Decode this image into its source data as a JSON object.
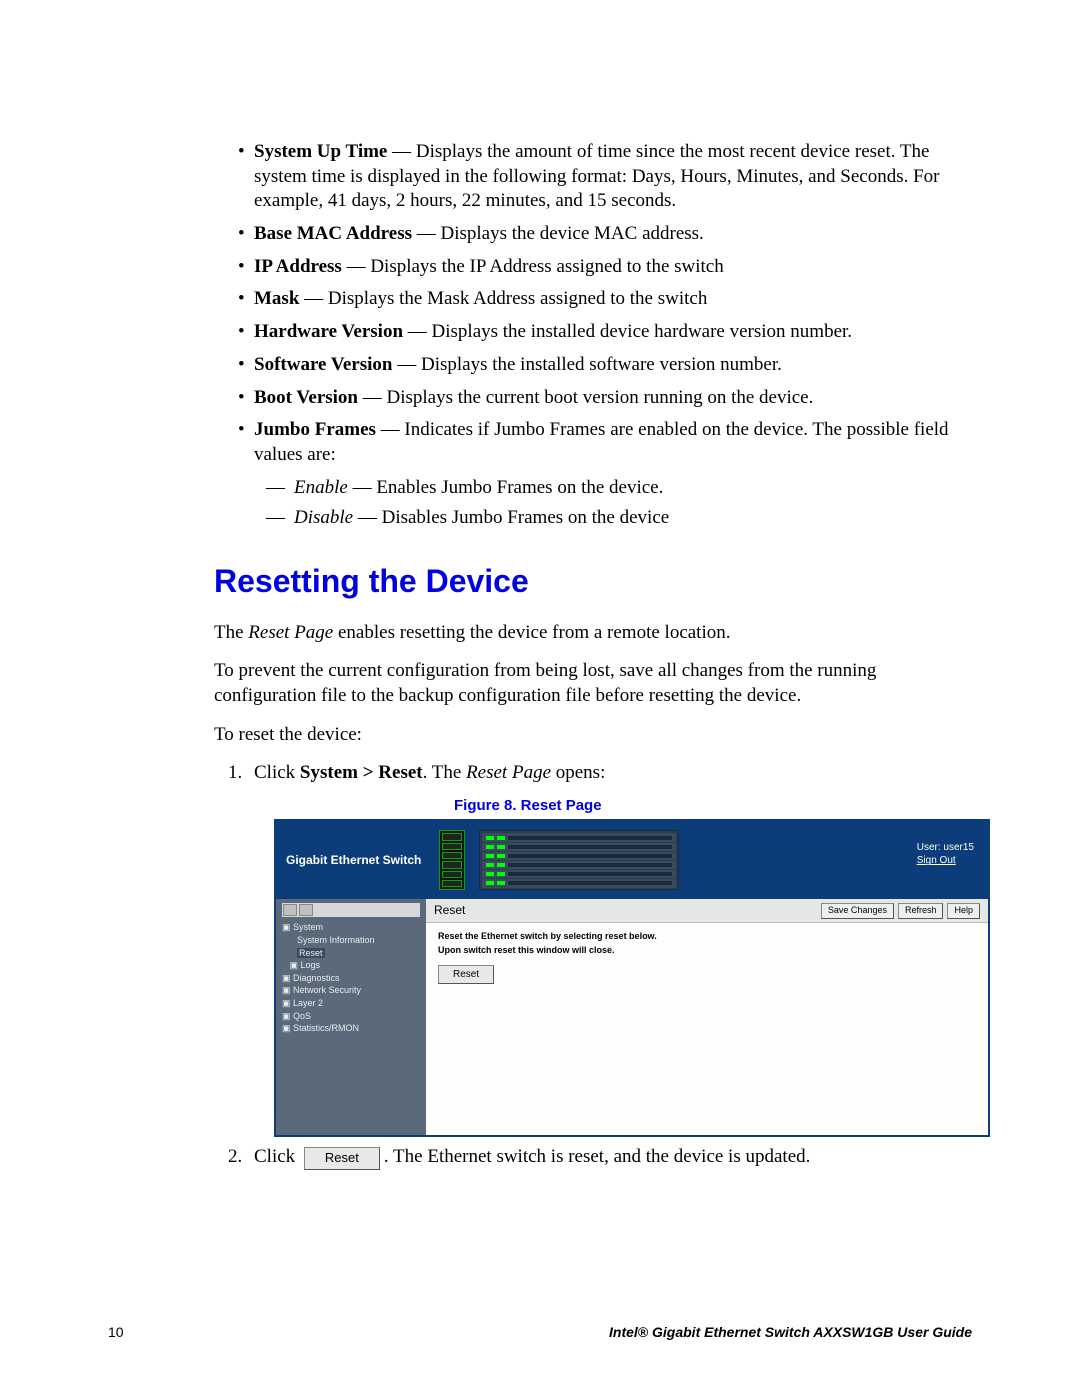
{
  "bullets": [
    {
      "term": "System Up Time",
      "desc": " — Displays the amount of time since the most recent device reset. The system time is displayed in the following format: Days, Hours, Minutes, and Seconds. For example, 41 days, 2 hours, 22 minutes, and 15 seconds."
    },
    {
      "term": "Base MAC Address",
      "desc": " — Displays the device MAC address."
    },
    {
      "term": "IP Address",
      "desc": " — Displays the IP Address assigned to the switch"
    },
    {
      "term": "Mask",
      "desc": " — Displays the Mask Address assigned to the switch"
    },
    {
      "term": "Hardware Version",
      "desc": " — Displays the installed device hardware version number."
    },
    {
      "term": "Software Version",
      "desc": " — Displays the installed software version number."
    },
    {
      "term": "Boot Version",
      "desc": " — Displays the current boot version running on the device."
    },
    {
      "term": "Jumbo Frames",
      "desc": " — Indicates if Jumbo Frames are enabled on the device. The possible field values are:"
    }
  ],
  "sub_bullets": [
    {
      "term": "Enable",
      "desc": " — Enables Jumbo Frames on the device."
    },
    {
      "term": "Disable",
      "desc": " — Disables Jumbo Frames on the device"
    }
  ],
  "heading": "Resetting the Device",
  "para1_pre": "The ",
  "para1_em": "Reset Page",
  "para1_post": " enables resetting the device from a remote location.",
  "para2": "To prevent the current configuration from being lost, save all changes from the running configuration file to the backup configuration file before resetting the device.",
  "para3": "To reset the device:",
  "step1_pre": "Click ",
  "step1_bold": "System > Reset",
  "step1_mid": ". The ",
  "step1_em": "Reset Page",
  "step1_post": " opens:",
  "fig_caption": "Figure 8. Reset Page",
  "fig": {
    "product": "Gigabit Ethernet Switch",
    "user_line1": "User: user15",
    "user_line2": "Sign Out",
    "tree": {
      "l0": "▣ System",
      "l1": "System Information",
      "l2": "Reset",
      "l3": "▣ Logs",
      "l4": "▣ Diagnostics",
      "l5": "▣ Network Security",
      "l6": "▣ Layer 2",
      "l7": "▣ QoS",
      "l8": "▣ Statistics/RMON"
    },
    "crumb": "Reset",
    "btn_save": "Save Changes",
    "btn_refresh": "Refresh",
    "btn_help": "Help",
    "msg1": "Reset the Ethernet switch by selecting reset below.",
    "msg2": "Upon switch reset this window will close.",
    "btn_reset": "Reset"
  },
  "step2_pre": "Click ",
  "step2_btn": "Reset",
  "step2_post": ". The Ethernet switch is reset, and the device is updated.",
  "footer_page": "10",
  "footer_doc": "Intel® Gigabit Ethernet Switch AXXSW1GB User Guide"
}
